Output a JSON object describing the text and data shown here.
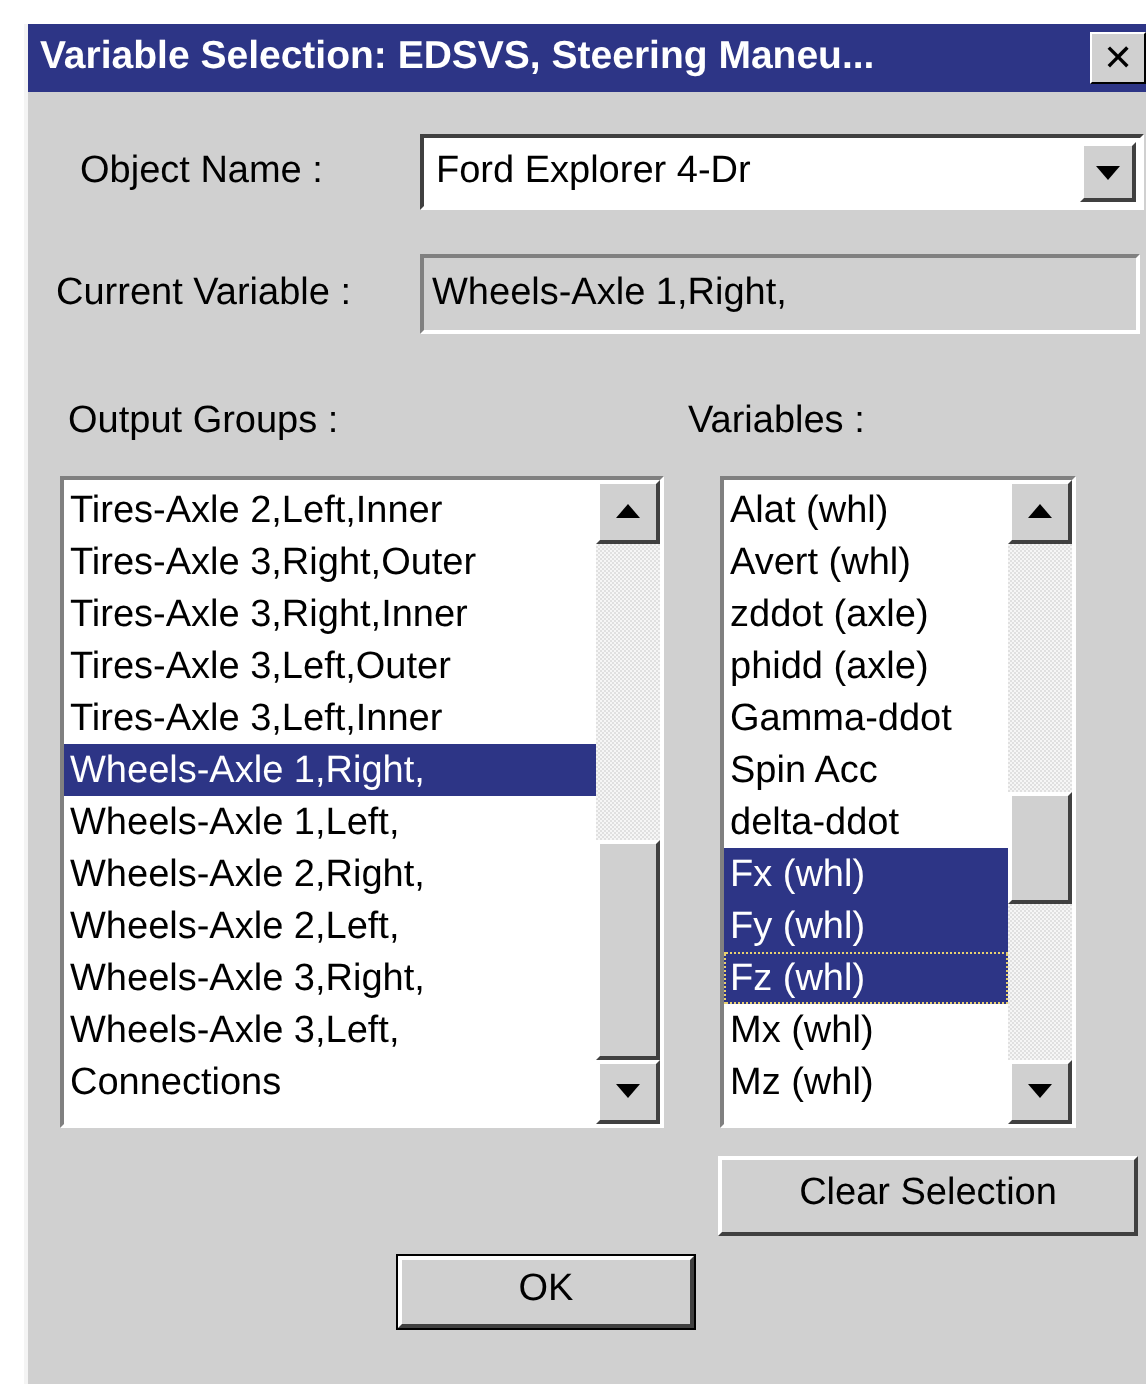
{
  "window": {
    "title": "Variable Selection: EDSVS, Steering Maneu...",
    "close": "✕"
  },
  "object_name": {
    "label": "Object Name :",
    "value": "Ford Explorer 4-Dr"
  },
  "current_variable": {
    "label": "Current Variable :",
    "value": "Wheels-Axle 1,Right,"
  },
  "output_groups": {
    "label": "Output Groups :",
    "items": [
      {
        "text": "Tires-Axle 2,Left,Inner",
        "selected": false
      },
      {
        "text": "Tires-Axle 3,Right,Outer",
        "selected": false
      },
      {
        "text": "Tires-Axle 3,Right,Inner",
        "selected": false
      },
      {
        "text": "Tires-Axle 3,Left,Outer",
        "selected": false
      },
      {
        "text": "Tires-Axle 3,Left,Inner",
        "selected": false
      },
      {
        "text": "Wheels-Axle 1,Right,",
        "selected": true
      },
      {
        "text": "Wheels-Axle 1,Left,",
        "selected": false
      },
      {
        "text": "Wheels-Axle 2,Right,",
        "selected": false
      },
      {
        "text": "Wheels-Axle 2,Left,",
        "selected": false
      },
      {
        "text": "Wheels-Axle 3,Right,",
        "selected": false
      },
      {
        "text": "Wheels-Axle 3,Left,",
        "selected": false
      },
      {
        "text": "Connections",
        "selected": false
      }
    ]
  },
  "variables": {
    "label": "Variables :",
    "items": [
      {
        "text": "Alat (whl)",
        "selected": false,
        "focused": false
      },
      {
        "text": "Avert (whl)",
        "selected": false,
        "focused": false
      },
      {
        "text": "zddot (axle)",
        "selected": false,
        "focused": false
      },
      {
        "text": "phidd (axle)",
        "selected": false,
        "focused": false
      },
      {
        "text": "Gamma-ddot",
        "selected": false,
        "focused": false
      },
      {
        "text": "Spin Acc",
        "selected": false,
        "focused": false
      },
      {
        "text": "delta-ddot",
        "selected": false,
        "focused": false
      },
      {
        "text": "Fx (whl)",
        "selected": true,
        "focused": false
      },
      {
        "text": "Fy (whl)",
        "selected": true,
        "focused": false
      },
      {
        "text": "Fz (whl)",
        "selected": true,
        "focused": true
      },
      {
        "text": "Mx (whl)",
        "selected": false,
        "focused": false
      },
      {
        "text": "Mz (whl)",
        "selected": false,
        "focused": false
      }
    ]
  },
  "buttons": {
    "clear": "Clear Selection",
    "ok": "OK"
  }
}
